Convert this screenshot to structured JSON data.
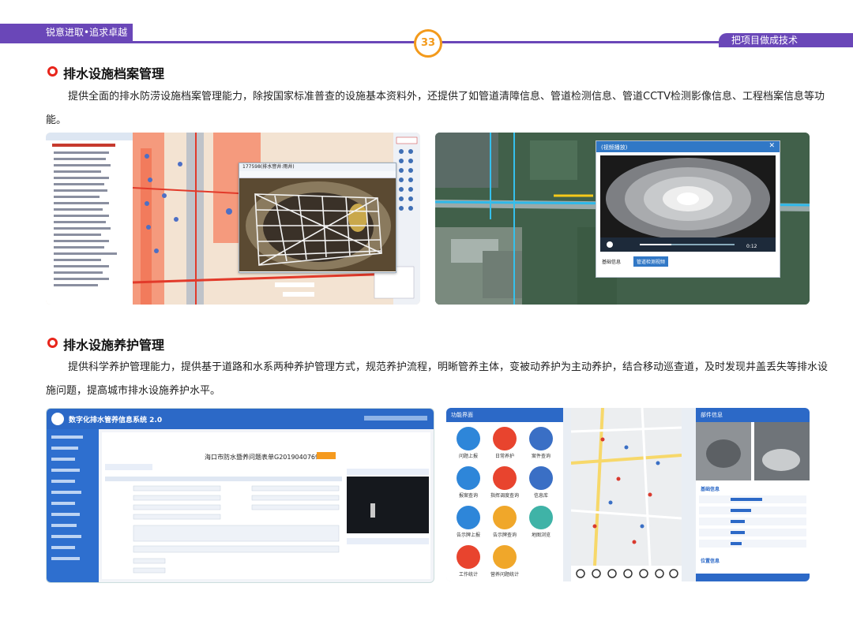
{
  "header": {
    "left_tag": "锐意进取•追求卓越",
    "right_tag": "把项目做成技术",
    "page_number": "33"
  },
  "section1": {
    "title": "排水设施档案管理",
    "paragraph": "提供全面的排水防涝设施档案管理能力，除按国家标准普查的设施基本资料外，还提供了如管道清障信息、管道检测信息、管道CCTV检测影像信息、工程档案信息等功能。"
  },
  "section2": {
    "title": "排水设施养护管理",
    "paragraph": "提供科学养护管理能力，提供基于道路和水系两种养护管理方式，规范养护流程，明晰管养主体，变被动养护为主动养护，结合移动巡查道，及时发现井盖丢失等排水设施问题，提高城市排水设施养护水平。"
  },
  "shot1": {
    "popup_title": "177598(排水窨井:雨井)",
    "time": "0:12"
  },
  "shot2": {
    "window_title": "(视频播放)",
    "tab1": "基础信息",
    "tab2": "管道检测视频"
  },
  "shot3": {
    "system_title": "数字化排水管养信息系统 2.0",
    "form_title": "海口市防水暨养问题表单G20190407699"
  },
  "shot4": {
    "app_title": "功能界面",
    "detail_title": "部件信息",
    "icons": [
      "问题上报",
      "日常养护",
      "案件查询",
      "报案查询",
      "指挥调度查询",
      "信息库",
      "告示牌上报",
      "告示牌查询",
      "地图浏览",
      "工作统计",
      "营养问题统计"
    ],
    "basic_info": "基础信息",
    "location_info": "位置信息"
  }
}
